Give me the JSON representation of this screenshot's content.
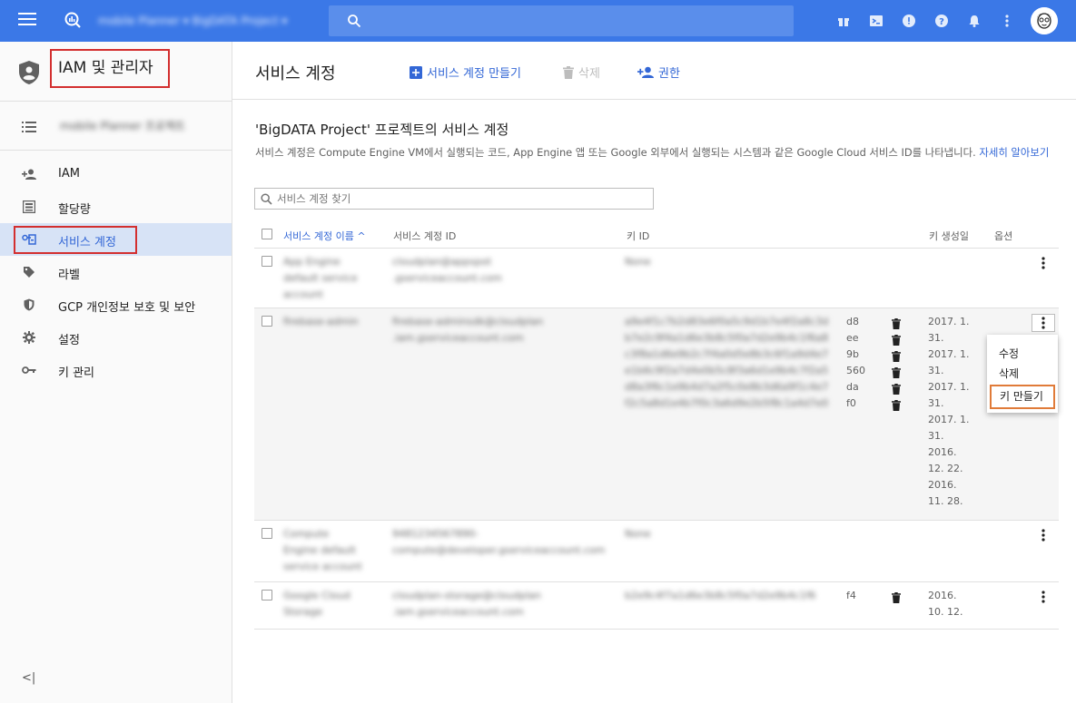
{
  "app": {
    "title": "IAM 및 관리자",
    "project_selector": "▾"
  },
  "sidebar": {
    "title": "IAM 및 관리자",
    "items": [
      {
        "label": "IAM",
        "icon": "person-add-icon"
      },
      {
        "label": "할당량",
        "icon": "quota-icon"
      },
      {
        "label": "서비스 계정",
        "icon": "service-account-icon"
      },
      {
        "label": "라벨",
        "icon": "label-icon"
      },
      {
        "label": "GCP 개인정보 보호 및 보안",
        "icon": "shield-icon"
      },
      {
        "label": "설정",
        "icon": "gear-icon"
      },
      {
        "label": "키 관리",
        "icon": "key-icon"
      }
    ],
    "collapse": "<|"
  },
  "header": {
    "title": "서비스 계정",
    "create_label": "서비스 계정 만들기",
    "delete_label": "삭제",
    "permissions_label": "권한"
  },
  "section": {
    "title": "'BigDATA Project' 프로젝트의 서비스 계정",
    "description": "서비스 계정은 Compute Engine VM에서 실행되는 코드, App Engine 앱 또는 Google 외부에서 실행되는 시스템과 같은 Google Cloud 서비스 ID를 나타냅니다.",
    "learn_more": "자세히 알아보기",
    "filter_placeholder": "서비스 계정 찾기"
  },
  "table": {
    "columns": {
      "name": "서비스 계정 이름 ^",
      "id": "서비스 계정 ID",
      "key_id": "키 ID",
      "created": "키 생성일",
      "options": "옵션"
    },
    "rows": [
      {
        "key_tails": [],
        "dates": []
      },
      {
        "key_tails": [
          "d8",
          "ee",
          "9b",
          "560",
          "da",
          "f0"
        ],
        "dates": [
          "2017. 1.",
          "31.",
          "2017. 1.",
          "31.",
          "2017. 1.",
          "31.",
          "2017. 1.",
          "31.",
          "2016.",
          "12. 22.",
          "2016.",
          "11. 28."
        ]
      },
      {
        "key_tails": [],
        "dates": []
      },
      {
        "key_tails": [
          "f4"
        ],
        "dates": [
          "2016.",
          "10. 12."
        ]
      }
    ]
  },
  "context_menu": {
    "edit": "수정",
    "delete": "삭제",
    "create_key": "키 만들기"
  }
}
